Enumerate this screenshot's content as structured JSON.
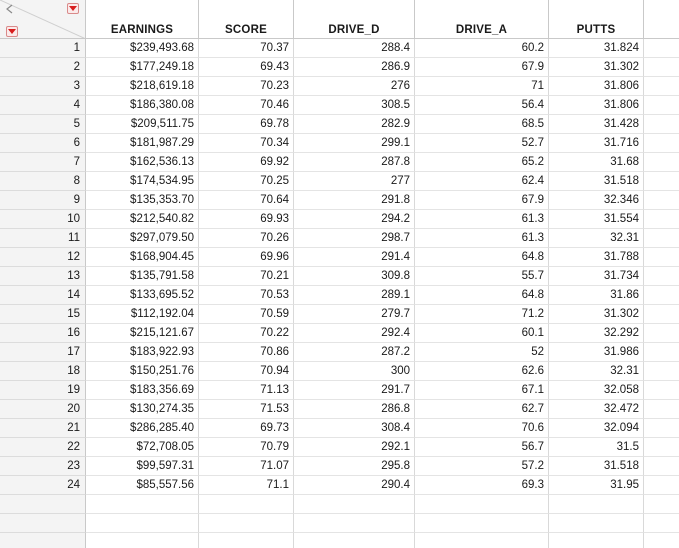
{
  "columns": [
    "EARNINGS",
    "SCORE",
    "DRIVE_D",
    "DRIVE_A",
    "PUTTS"
  ],
  "row_numbers": [
    "1",
    "2",
    "3",
    "4",
    "5",
    "6",
    "7",
    "8",
    "9",
    "10",
    "11",
    "12",
    "13",
    "14",
    "15",
    "16",
    "17",
    "18",
    "19",
    "20",
    "21",
    "22",
    "23",
    "24"
  ],
  "rows": [
    [
      "$239,493.68",
      "70.37",
      "288.4",
      "60.2",
      "31.824"
    ],
    [
      "$177,249.18",
      "69.43",
      "286.9",
      "67.9",
      "31.302"
    ],
    [
      "$218,619.18",
      "70.23",
      "276",
      "71",
      "31.806"
    ],
    [
      "$186,380.08",
      "70.46",
      "308.5",
      "56.4",
      "31.806"
    ],
    [
      "$209,511.75",
      "69.78",
      "282.9",
      "68.5",
      "31.428"
    ],
    [
      "$181,987.29",
      "70.34",
      "299.1",
      "52.7",
      "31.716"
    ],
    [
      "$162,536.13",
      "69.92",
      "287.8",
      "65.2",
      "31.68"
    ],
    [
      "$174,534.95",
      "70.25",
      "277",
      "62.4",
      "31.518"
    ],
    [
      "$135,353.70",
      "70.64",
      "291.8",
      "67.9",
      "32.346"
    ],
    [
      "$212,540.82",
      "69.93",
      "294.2",
      "61.3",
      "31.554"
    ],
    [
      "$297,079.50",
      "70.26",
      "298.7",
      "61.3",
      "32.31"
    ],
    [
      "$168,904.45",
      "69.96",
      "291.4",
      "64.8",
      "31.788"
    ],
    [
      "$135,791.58",
      "70.21",
      "309.8",
      "55.7",
      "31.734"
    ],
    [
      "$133,695.52",
      "70.53",
      "289.1",
      "64.8",
      "31.86"
    ],
    [
      "$112,192.04",
      "70.59",
      "279.7",
      "71.2",
      "31.302"
    ],
    [
      "$215,121.67",
      "70.22",
      "292.4",
      "60.1",
      "32.292"
    ],
    [
      "$183,922.93",
      "70.86",
      "287.2",
      "52",
      "31.986"
    ],
    [
      "$150,251.76",
      "70.94",
      "300",
      "62.6",
      "32.31"
    ],
    [
      "$183,356.69",
      "71.13",
      "291.7",
      "67.1",
      "32.058"
    ],
    [
      "$130,274.35",
      "71.53",
      "286.8",
      "62.7",
      "32.472"
    ],
    [
      "$286,285.40",
      "69.73",
      "308.4",
      "70.6",
      "32.094"
    ],
    [
      "$72,708.05",
      "70.79",
      "292.1",
      "56.7",
      "31.5"
    ],
    [
      "$99,597.31",
      "71.07",
      "295.8",
      "57.2",
      "31.518"
    ],
    [
      "$85,557.56",
      "71.1",
      "290.4",
      "69.3",
      "31.95"
    ]
  ],
  "empty_rows": 3,
  "icons": {
    "corner_arrow": "arrow-left-icon",
    "columns_menu": "red-triangle-menu-icon",
    "rows_menu": "red-triangle-menu-icon"
  },
  "colors": {
    "menu_triangle": "#d81e1e",
    "header_bg": "#f4f4f4",
    "grid_line": "#c9c9c9"
  }
}
